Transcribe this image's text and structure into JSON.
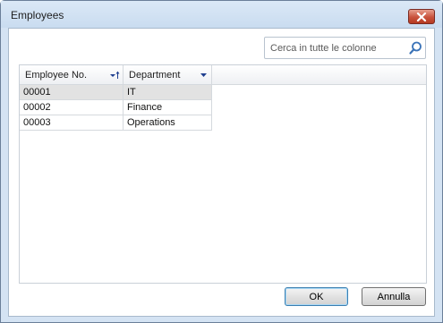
{
  "window": {
    "title": "Employees"
  },
  "search": {
    "placeholder": "Cerca in tutte le colonne",
    "value": ""
  },
  "grid": {
    "columns": [
      {
        "label": "Employee No."
      },
      {
        "label": "Department"
      }
    ],
    "rows": [
      {
        "employee_no": "00001",
        "department": "IT",
        "selected": true
      },
      {
        "employee_no": "00002",
        "department": "Finance",
        "selected": false
      },
      {
        "employee_no": "00003",
        "department": "Operations",
        "selected": false
      }
    ]
  },
  "buttons": {
    "ok_label": "OK",
    "cancel_label": "Annulla"
  },
  "colors": {
    "title_bar": "#c9dcf0",
    "close_button": "#c9533d",
    "selected_row": "#e2e2e2",
    "sort_indicator": "#1f3f8f"
  }
}
